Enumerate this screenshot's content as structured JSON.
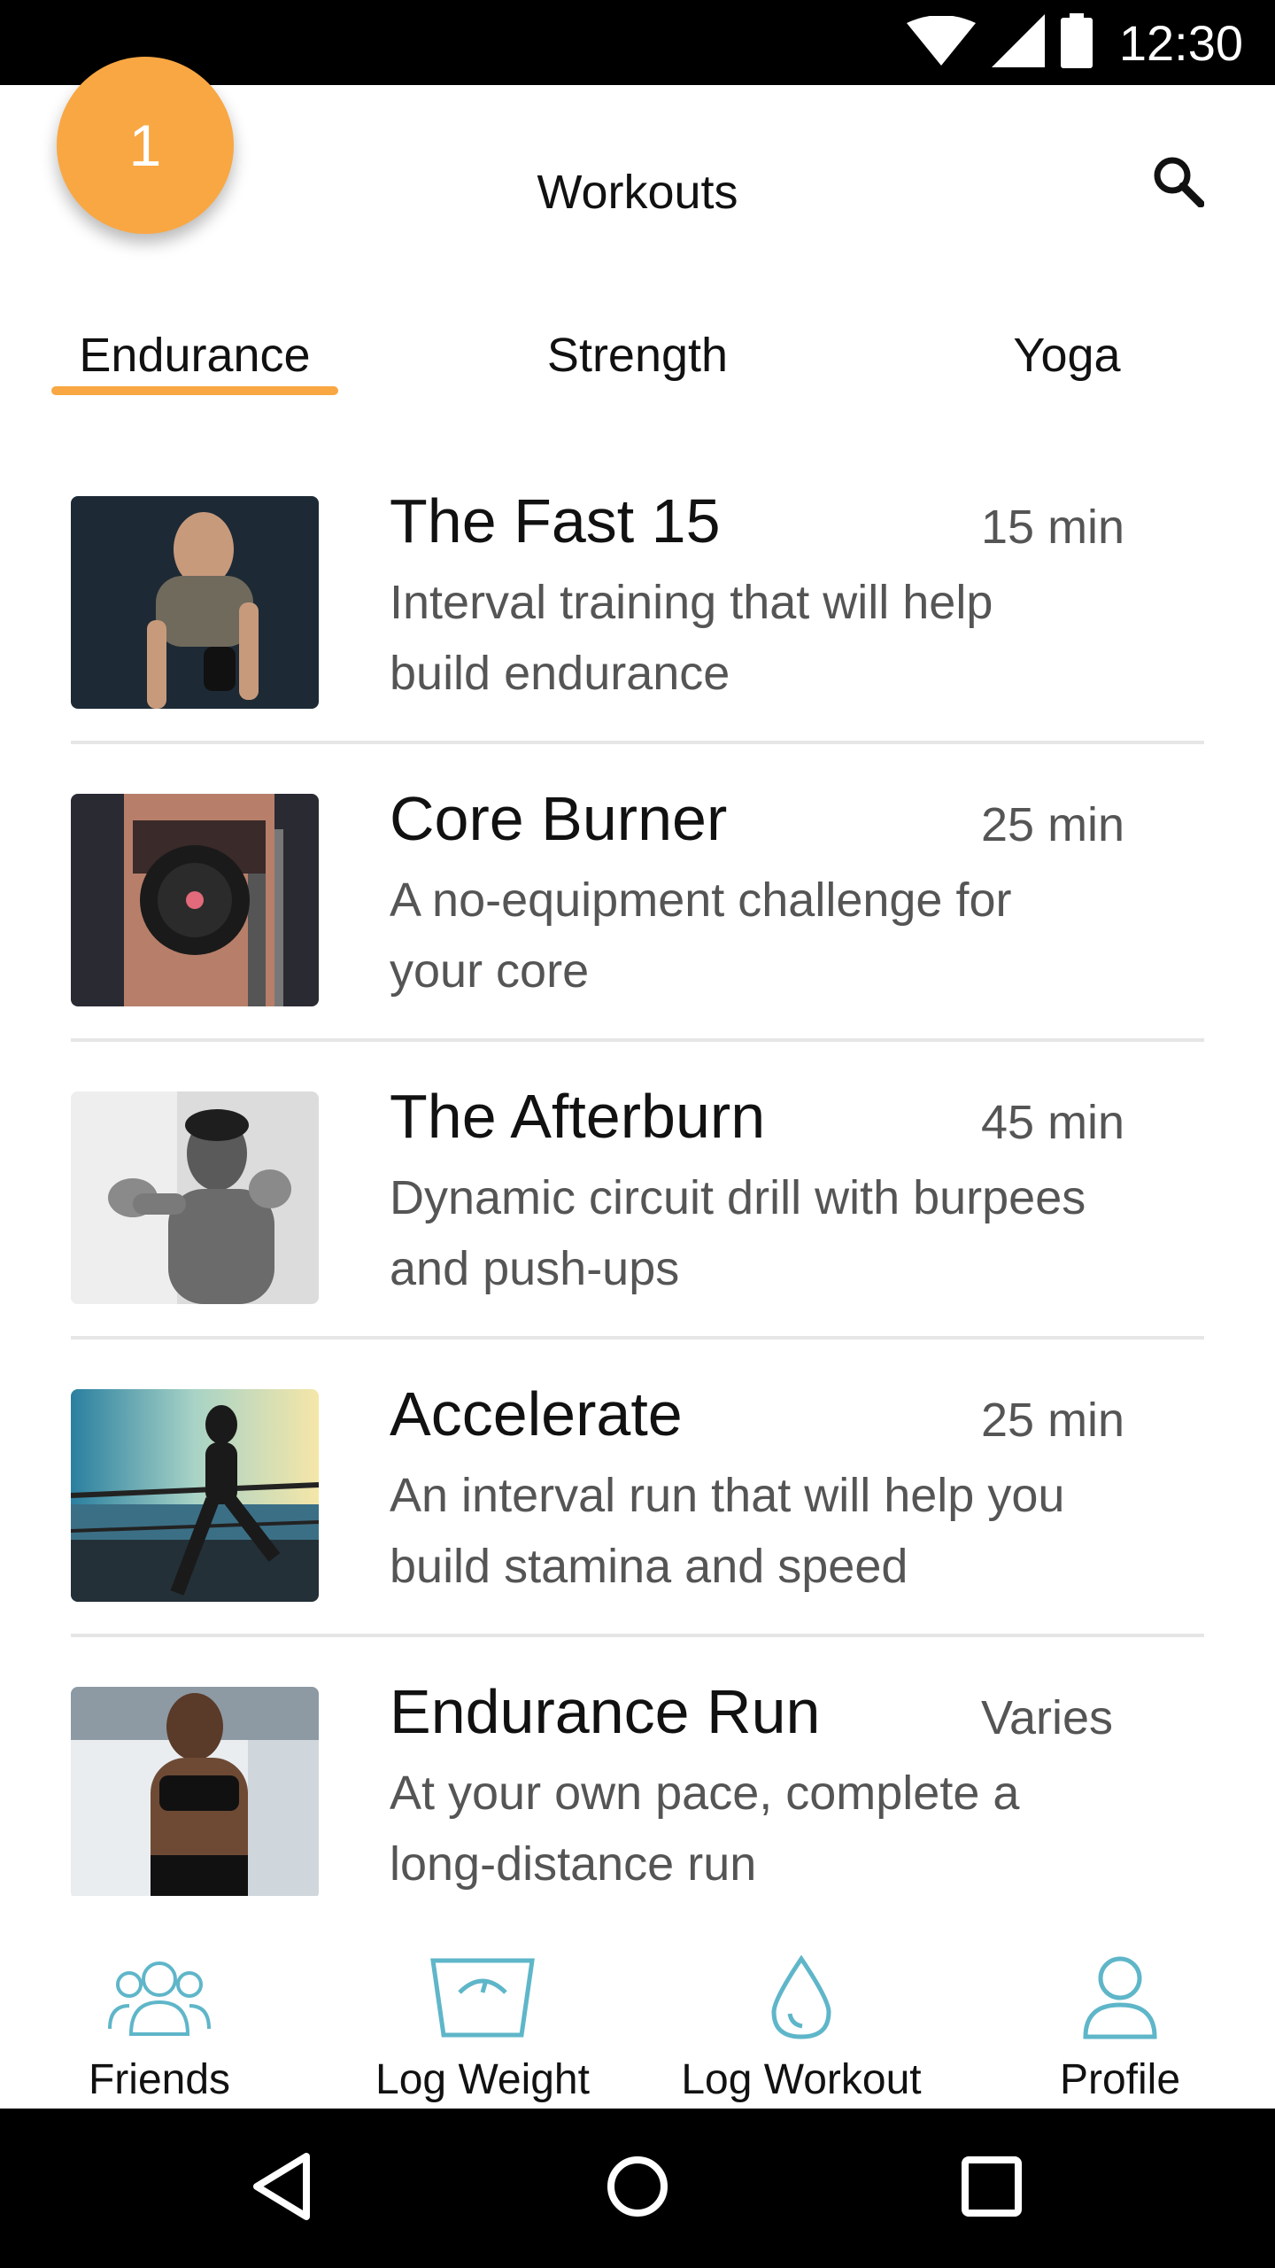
{
  "status_bar": {
    "time": "12:30",
    "icons": [
      "wifi-icon",
      "signal-icon",
      "battery-icon"
    ]
  },
  "badge": {
    "count": "1"
  },
  "app_bar": {
    "title": "Workouts",
    "search_icon": "search-icon"
  },
  "tabs": [
    {
      "label": "Endurance",
      "selected": true
    },
    {
      "label": "Strength",
      "selected": false
    },
    {
      "label": "Yoga",
      "selected": false
    }
  ],
  "workouts": [
    {
      "title": "The Fast 15",
      "duration": "15 min",
      "description": "Interval training that will help build endurance"
    },
    {
      "title": "Core Burner",
      "duration": "25  min",
      "description": "A no-equipment challenge for your core"
    },
    {
      "title": "The Afterburn",
      "duration": "45 min",
      "description": "Dynamic circuit drill with burpees and push-ups"
    },
    {
      "title": "Accelerate",
      "duration": "25 min",
      "description": "An interval run that will help you build stamina and speed"
    },
    {
      "title": "Endurance Run",
      "duration": "Varies",
      "description": "At your own pace, complete a long-distance run"
    }
  ],
  "bottom_nav": [
    {
      "label": "Friends",
      "icon": "friends-icon"
    },
    {
      "label": "Log Weight",
      "icon": "scale-icon"
    },
    {
      "label": "Log Workout",
      "icon": "water-drop-icon"
    },
    {
      "label": "Profile",
      "icon": "profile-icon"
    }
  ],
  "colors": {
    "accent": "#f9a743",
    "nav_icon": "#5fb6c9",
    "text_primary": "#111111",
    "text_secondary": "#555555"
  }
}
